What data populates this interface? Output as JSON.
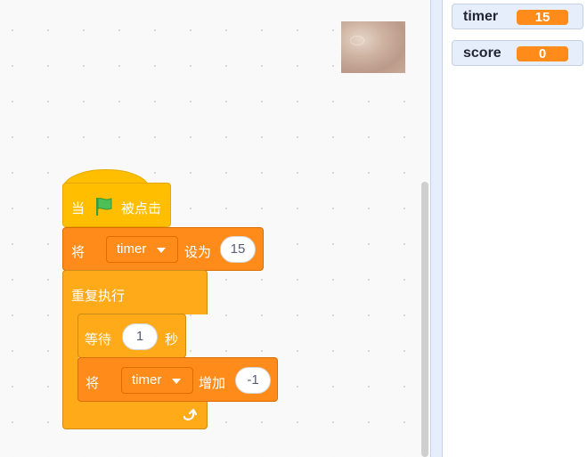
{
  "monitors": [
    {
      "name": "timer",
      "value": "15"
    },
    {
      "name": "score",
      "value": "0"
    }
  ],
  "script": {
    "hat": {
      "prefix": "当",
      "suffix": "被点击",
      "icon": "green-flag-icon"
    },
    "set": {
      "prefix": "将",
      "variable": "timer",
      "mid": "设为",
      "value": "15"
    },
    "repeat": {
      "label": "重复执行",
      "loop_icon": "loop-arrow-icon"
    },
    "wait": {
      "prefix": "等待",
      "value": "1",
      "suffix": "秒"
    },
    "change": {
      "prefix": "将",
      "variable": "timer",
      "mid": "增加",
      "value": "-1"
    }
  },
  "colors": {
    "events": "#ffbf00",
    "variables": "#ff8c1a",
    "control": "#ffab19",
    "monitor_value": "#ff8c1a"
  }
}
